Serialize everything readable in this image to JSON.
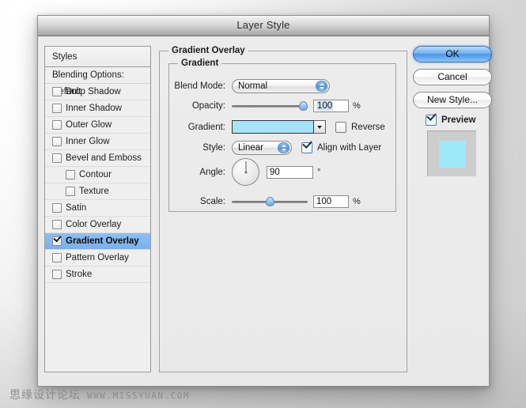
{
  "window": {
    "title": "Layer Style"
  },
  "sidebar": {
    "header": "Styles",
    "blending_options": "Blending Options: Default",
    "items": [
      {
        "label": "Drop Shadow",
        "checked": false,
        "indent": false,
        "selected": false
      },
      {
        "label": "Inner Shadow",
        "checked": false,
        "indent": false,
        "selected": false
      },
      {
        "label": "Outer Glow",
        "checked": false,
        "indent": false,
        "selected": false
      },
      {
        "label": "Inner Glow",
        "checked": false,
        "indent": false,
        "selected": false
      },
      {
        "label": "Bevel and Emboss",
        "checked": false,
        "indent": false,
        "selected": false
      },
      {
        "label": "Contour",
        "checked": false,
        "indent": true,
        "selected": false
      },
      {
        "label": "Texture",
        "checked": false,
        "indent": true,
        "selected": false
      },
      {
        "label": "Satin",
        "checked": false,
        "indent": false,
        "selected": false
      },
      {
        "label": "Color Overlay",
        "checked": false,
        "indent": false,
        "selected": false
      },
      {
        "label": "Gradient Overlay",
        "checked": true,
        "indent": false,
        "selected": true
      },
      {
        "label": "Pattern Overlay",
        "checked": false,
        "indent": false,
        "selected": false
      },
      {
        "label": "Stroke",
        "checked": false,
        "indent": false,
        "selected": false
      }
    ]
  },
  "main": {
    "group_title": "Gradient Overlay",
    "subgroup_title": "Gradient",
    "blend_mode": {
      "label": "Blend Mode:",
      "value": "Normal"
    },
    "opacity": {
      "label": "Opacity:",
      "value": "100",
      "unit": "%",
      "percent": 100
    },
    "gradient": {
      "label": "Gradient:",
      "color_start": "#a6e4f7",
      "color_end": "#a4e2f6"
    },
    "reverse": {
      "label": "Reverse",
      "checked": false
    },
    "style": {
      "label": "Style:",
      "value": "Linear"
    },
    "align_with_layer": {
      "label": "Align with Layer",
      "checked": true
    },
    "angle": {
      "label": "Angle:",
      "value": "90",
      "unit": "°",
      "degrees": 90
    },
    "scale": {
      "label": "Scale:",
      "value": "100",
      "unit": "%",
      "percent": 50
    }
  },
  "buttons": {
    "ok": "OK",
    "cancel": "Cancel",
    "new_style": "New Style...",
    "preview": {
      "label": "Preview",
      "checked": true
    },
    "preview_swatch_color": "#9de9fa"
  },
  "watermark": {
    "cn": "思缘设计论坛",
    "en": "WWW.MISSYUAN.COM"
  }
}
